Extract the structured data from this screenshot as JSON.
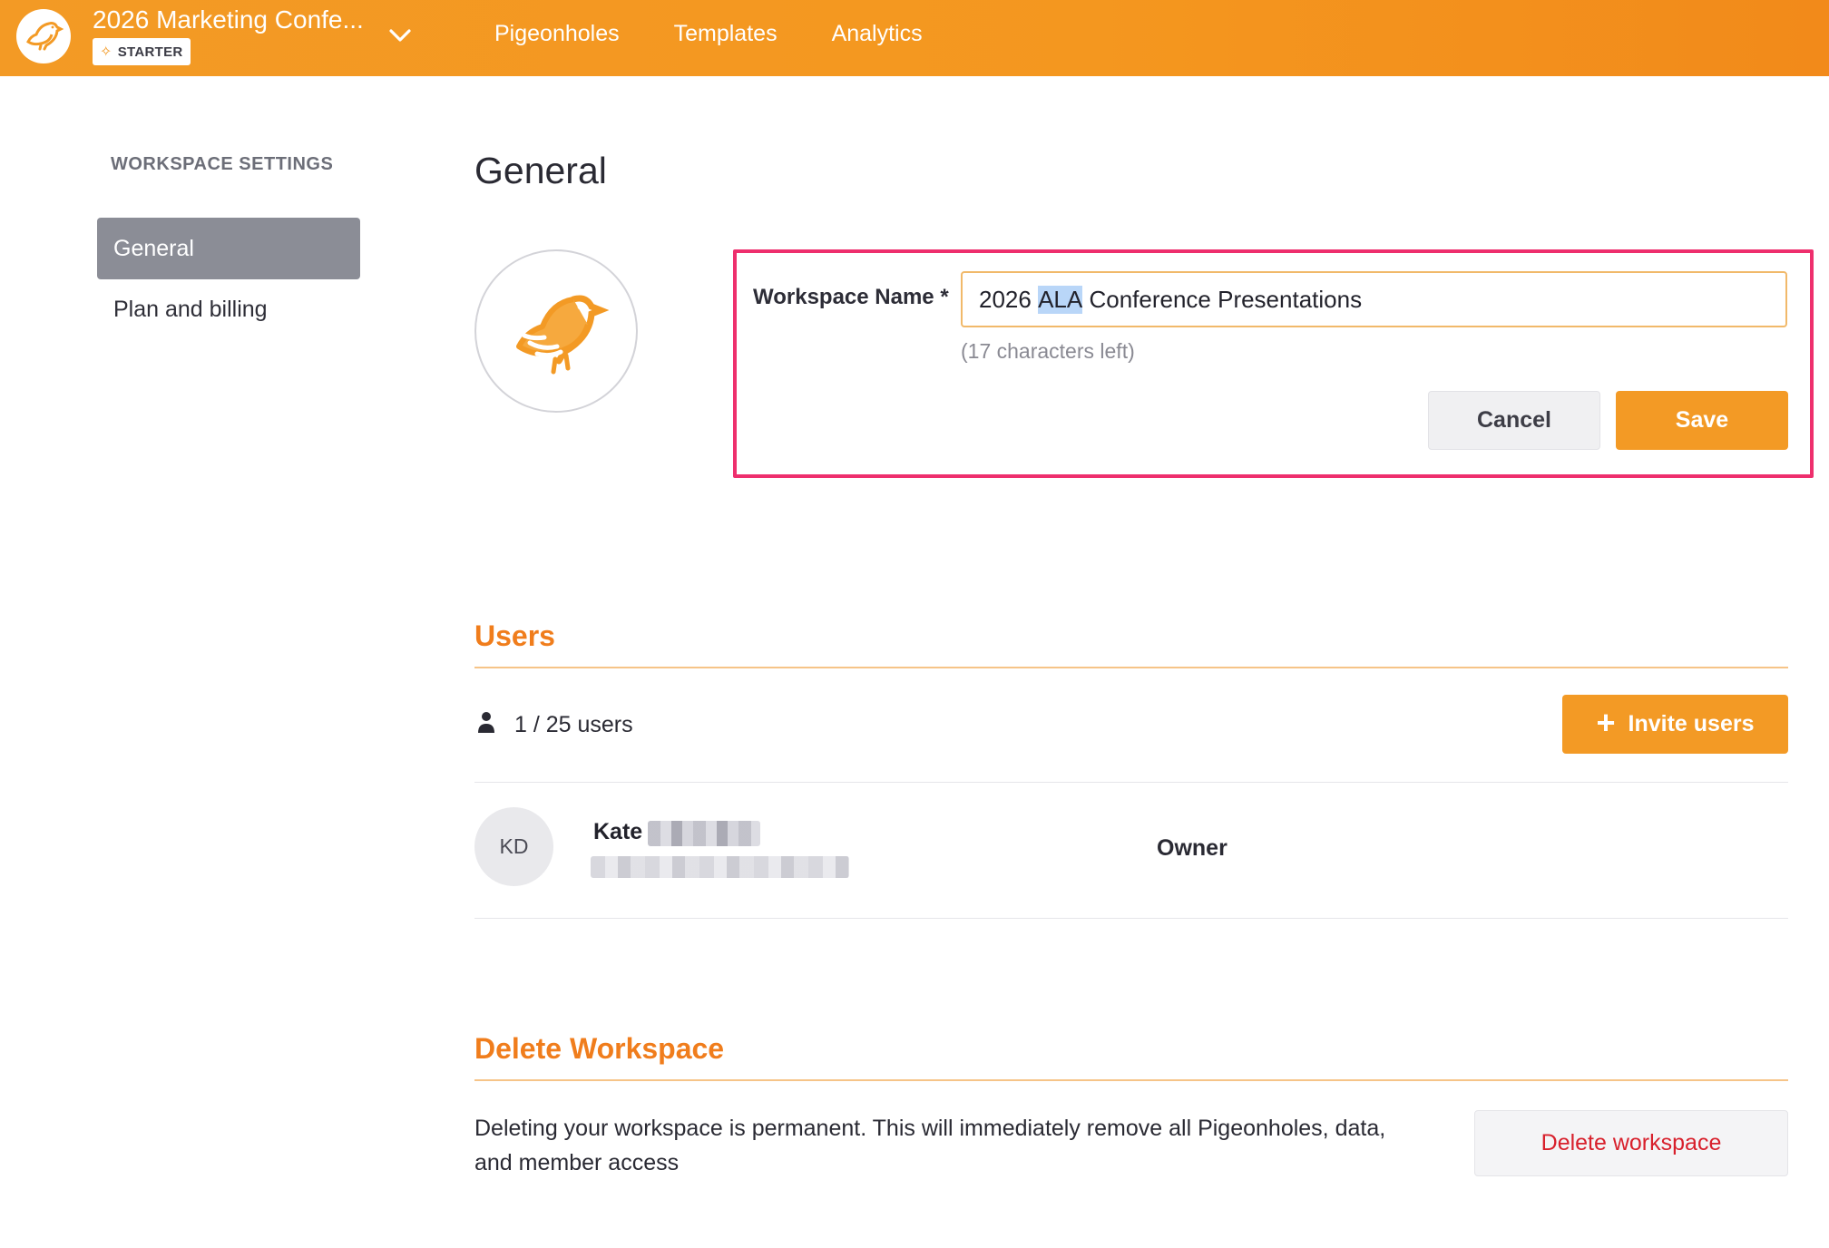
{
  "header": {
    "workspace_title": "2026 Marketing Confe...",
    "plan_badge": "STARTER",
    "nav": [
      "Pigeonholes",
      "Templates",
      "Analytics"
    ]
  },
  "sidebar": {
    "heading": "WORKSPACE SETTINGS",
    "items": [
      {
        "label": "General",
        "active": true
      },
      {
        "label": "Plan and billing",
        "active": false
      }
    ]
  },
  "general": {
    "title": "General",
    "field_label": "Workspace Name *",
    "name_value_before": "2026 ",
    "name_value_selected": "ALA",
    "name_value_after": " Conference Presentations",
    "chars_left": "(17 characters left)",
    "cancel_label": "Cancel",
    "save_label": "Save"
  },
  "users": {
    "title": "Users",
    "count": "1 / 25 users",
    "invite_label": "Invite users",
    "list": [
      {
        "initials": "KD",
        "first_name": "Kate",
        "role": "Owner"
      }
    ]
  },
  "delete": {
    "title": "Delete Workspace",
    "description": "Deleting your workspace is permanent. This will immediately remove all Pigeonholes, data, and member access",
    "button_label": "Delete workspace"
  },
  "colors": {
    "brand_orange": "#f39a25",
    "section_title": "#f07d1c",
    "highlight": "#ee2f6d",
    "danger": "#d8202c"
  },
  "icons": [
    "bird-logo-icon",
    "chevron-down-icon",
    "spark-icon",
    "person-icon",
    "plus-icon"
  ]
}
